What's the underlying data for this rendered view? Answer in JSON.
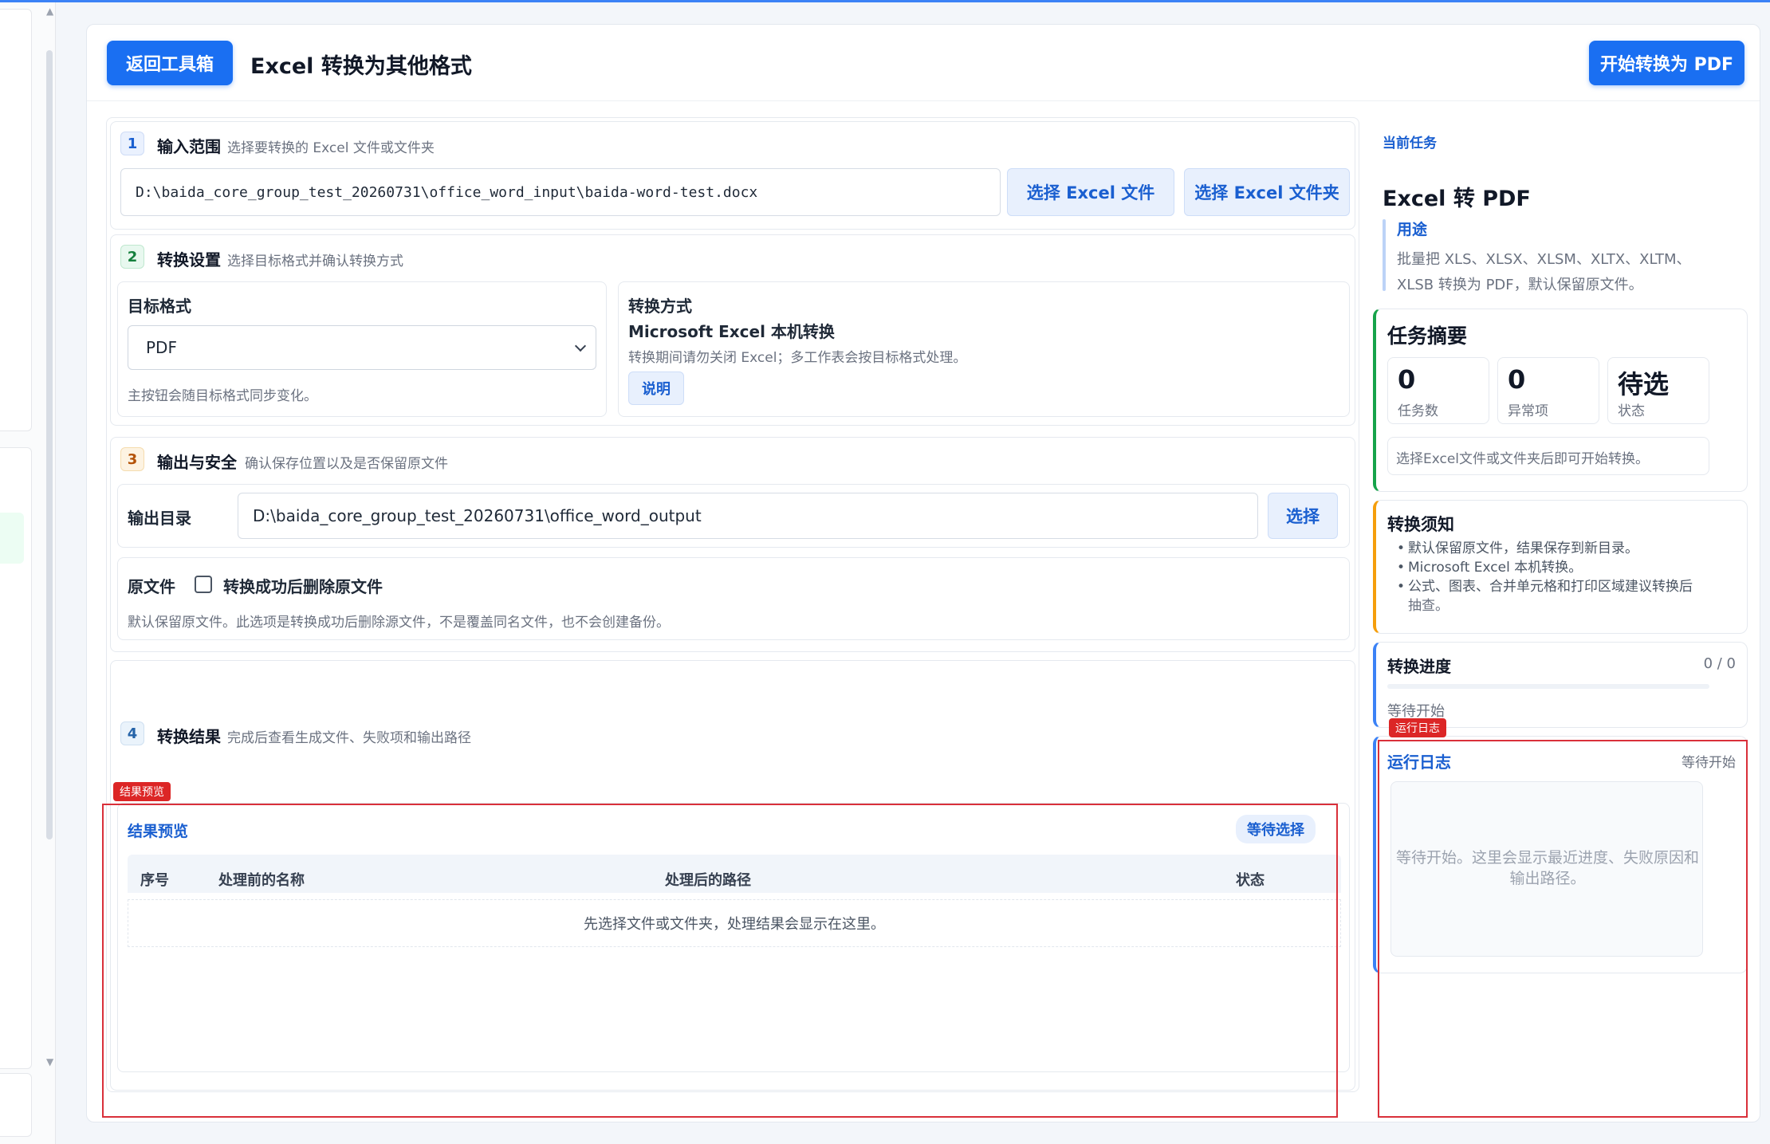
{
  "header": {
    "back_label": "返回工具箱",
    "title": "Excel 转换为其他格式",
    "start_label": "开始转换为 PDF"
  },
  "step1": {
    "num": "1",
    "title": "输入范围",
    "subtitle": "选择要转换的 Excel 文件或文件夹",
    "input_path": "D:\\baida_core_group_test_20260731\\office_word_input\\baida-word-test.docx",
    "select_file_label": "选择 Excel 文件",
    "select_folder_label": "选择 Excel 文件夹"
  },
  "step2": {
    "num": "2",
    "title": "转换设置",
    "subtitle": "选择目标格式并确认转换方式",
    "target_label": "目标格式",
    "target_value": "PDF",
    "target_hint": "主按钮会随目标格式同步变化。",
    "method_label": "转换方式",
    "method_value": "Microsoft Excel 本机转换",
    "method_hint": "转换期间请勿关闭 Excel；多工作表会按目标格式处理。",
    "explain_label": "说明"
  },
  "step3": {
    "num": "3",
    "title": "输出与安全",
    "subtitle": "确认保存位置以及是否保留原文件",
    "output_label": "输出目录",
    "output_path": "D:\\baida_core_group_test_20260731\\office_word_output",
    "choose_label": "选择",
    "origin_label": "原文件",
    "delete_label": "转换成功后删除原文件",
    "delete_hint": "默认保留原文件。此选项是转换成功后删除源文件，不是覆盖同名文件，也不会创建备份。"
  },
  "step4": {
    "num": "4",
    "title": "转换结果",
    "subtitle": "完成后查看生成文件、失败项和输出路径",
    "tag": "结果预览",
    "preview_title": "结果预览",
    "status_pill": "等待选择",
    "columns": [
      "序号",
      "处理前的名称",
      "处理后的路径",
      "状态"
    ],
    "empty_text": "先选择文件或文件夹，处理结果会显示在这里。"
  },
  "right": {
    "task_eyebrow": "当前任务",
    "task_title": "Excel 转 PDF",
    "purpose_label": "用途",
    "purpose_text_1": "批量把 XLS、XLSX、XLSM、XLTX、XLTM、",
    "purpose_text_2": "XLSB 转换为 PDF，默认保留原文件。",
    "summary_title": "任务摘要",
    "stats": [
      {
        "value": "0",
        "label": "任务数"
      },
      {
        "value": "0",
        "label": "异常项"
      },
      {
        "value": "待选",
        "label": "状态"
      }
    ],
    "summary_hint": "选择Excel文件或文件夹后即可开始转换。",
    "notice_title": "转换须知",
    "notices": [
      "默认保留原文件，结果保存到新目录。",
      "Microsoft Excel 本机转换。",
      "公式、图表、合并单元格和打印区域建议转换后",
      "抽查。"
    ],
    "progress_title": "转换进度",
    "progress_count": "0 / 0",
    "progress_fraction": 0,
    "progress_status": "等待开始",
    "log_tag": "运行日志",
    "log_title": "运行日志",
    "log_status": "等待开始",
    "log_text_1": "等待开始。这里会显示最近进度、失败原因和",
    "log_text_2": "输出路径。"
  },
  "colors": {
    "primary": "#1a6ff2",
    "annotation": "#d9303a"
  }
}
